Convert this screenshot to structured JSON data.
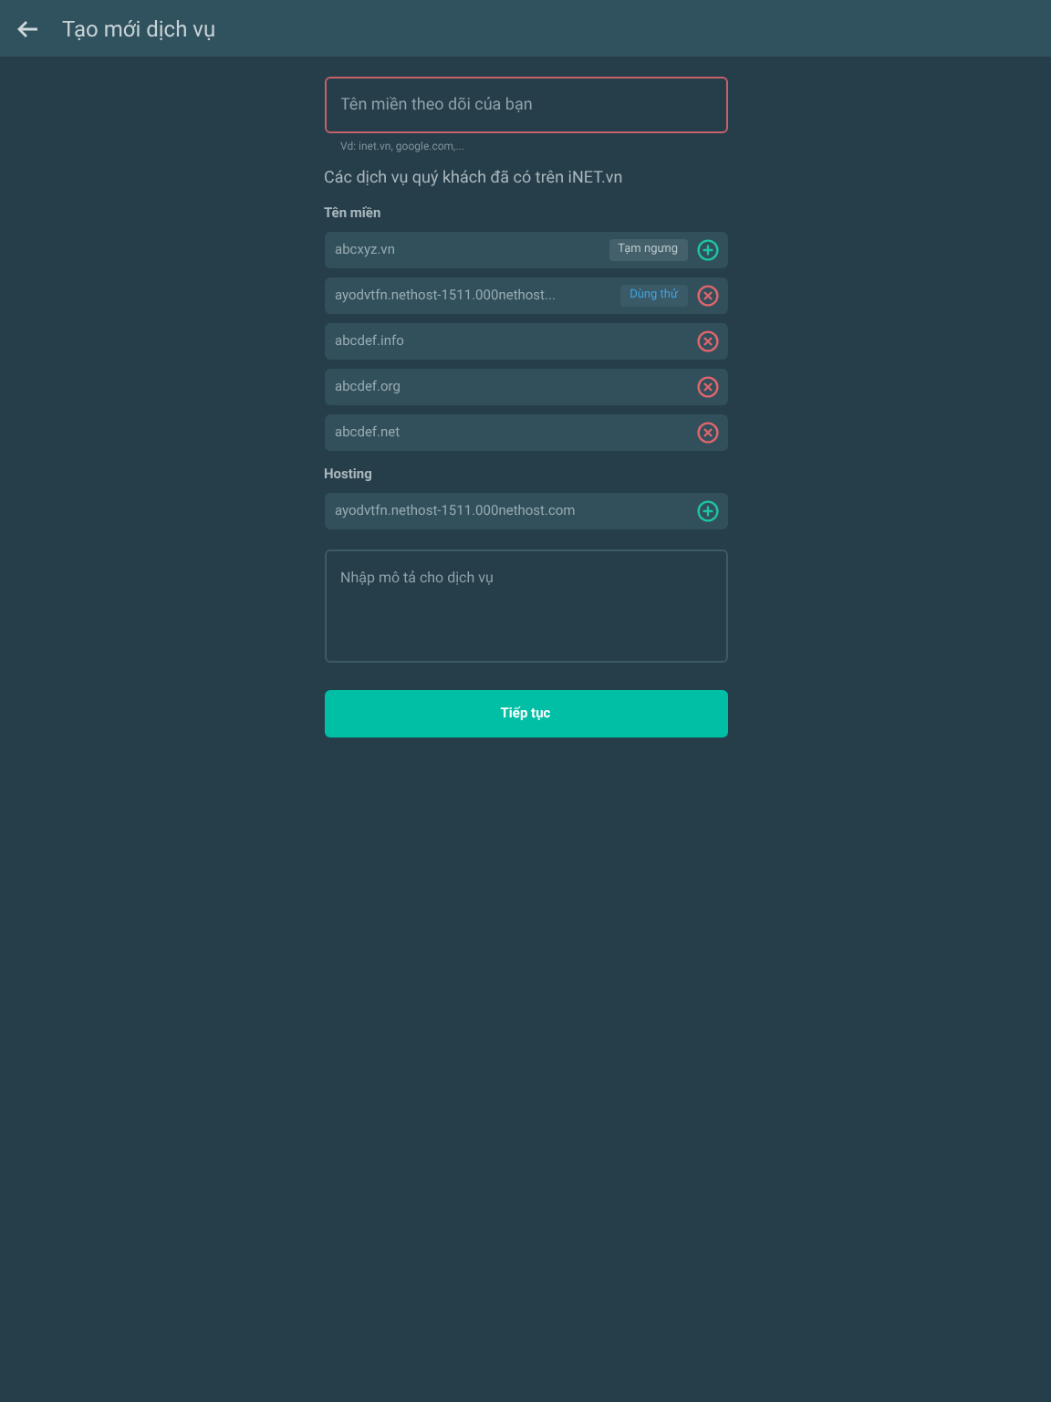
{
  "header": {
    "title": "Tạo mới dịch vụ"
  },
  "domain_field": {
    "placeholder": "Tên miền theo dõi của bạn",
    "error": true
  },
  "hint": "Vd: inet.vn, google.com,...",
  "section_title": "Các dịch vụ quý khách đã có trên iNET.vn",
  "groups": [
    {
      "title": "Tên miền",
      "items": [
        {
          "name": "abcxyz.vn",
          "badge": {
            "text": "Tạm ngưng",
            "kind": "suspended"
          },
          "kind": "add"
        },
        {
          "name": "ayodvtfn.nethost-1511.000nethost...",
          "badge": {
            "text": "Dùng thử",
            "kind": "trial"
          },
          "kind": "remove"
        },
        {
          "name": "abcdef.info",
          "kind": "remove"
        },
        {
          "name": "abcdef.org",
          "kind": "remove"
        },
        {
          "name": "abcdef.net",
          "kind": "remove"
        }
      ]
    },
    {
      "title": "Hosting",
      "items": [
        {
          "name": "ayodvtfn.nethost-1511.000nethost.com",
          "kind": "add"
        }
      ]
    }
  ],
  "description_field": {
    "placeholder": "Nhập mô tả cho dịch vụ"
  },
  "submit": "Tiếp tục"
}
